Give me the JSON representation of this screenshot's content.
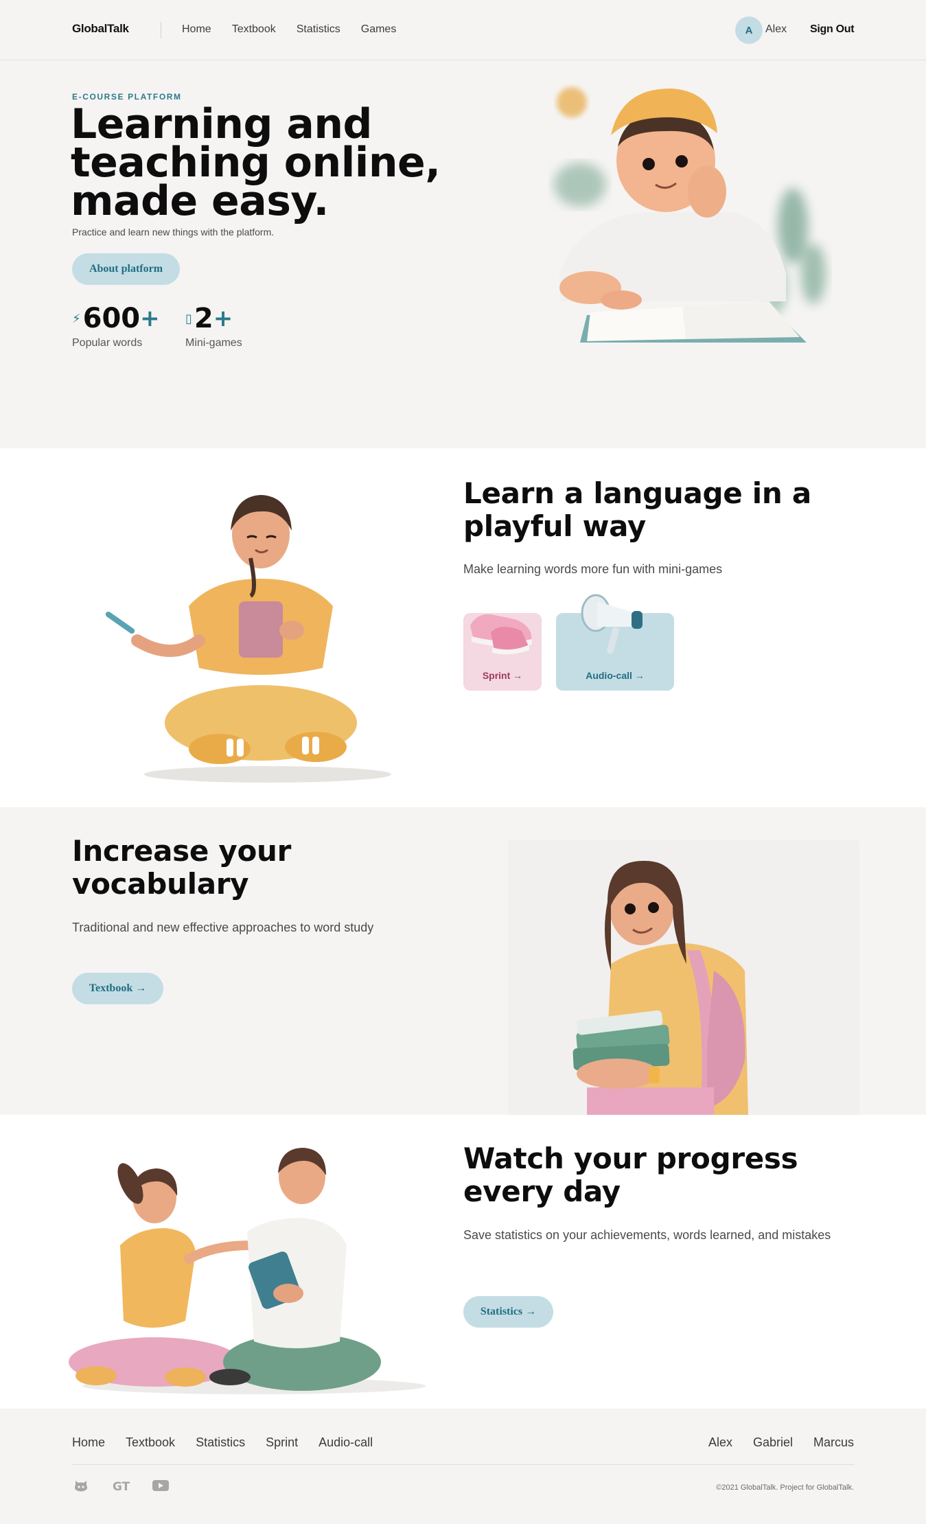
{
  "header": {
    "logo": "GlobalTalk",
    "nav": [
      "Home",
      "Textbook",
      "Statistics",
      "Games"
    ],
    "user": {
      "initial": "A",
      "name": "Alex"
    },
    "sign_out": "Sign Out"
  },
  "hero": {
    "eyebrow": "E-COURSE PLATFORM",
    "title": "Learning and teaching online, made easy.",
    "subtitle": "Practice and learn new things with the platform.",
    "button": "About platform",
    "stats": [
      {
        "value": "600",
        "suffix": "+",
        "label": "Popular words",
        "icon": "lightning-icon"
      },
      {
        "value": "2",
        "suffix": "+",
        "label": "Mini-games",
        "icon": "gamepad-icon"
      }
    ]
  },
  "games_section": {
    "title": "Learn a language in a playful way",
    "subtitle": "Make learning words more fun with mini-games",
    "cards": [
      {
        "label": "Sprint →",
        "icon": "sneaker-icon"
      },
      {
        "label": "Audio-call →",
        "icon": "megaphone-icon"
      }
    ]
  },
  "vocab_section": {
    "title": "Increase your vocabulary",
    "subtitle": "Traditional and new effective approaches to word study",
    "button": "Textbook →"
  },
  "progress_section": {
    "title": "Watch your progress every day",
    "subtitle": "Save statistics on your achievements, words learned, and mistakes",
    "button": "Statistics →"
  },
  "footer": {
    "nav": [
      "Home",
      "Textbook",
      "Statistics",
      "Sprint",
      "Audio-call"
    ],
    "authors": [
      "Alex",
      "Gabriel",
      "Marcus"
    ],
    "icons": [
      "github-icon",
      "gt-logo-icon",
      "youtube-icon"
    ],
    "gt_logo_text": "GT",
    "copyright": "©2021 GlobalTalk. Project for GlobalTalk."
  },
  "colors": {
    "accent": "#2a7a8a",
    "button_bg": "#c4dde4",
    "sprint_card": "#f4d8e2",
    "page_bg": "#f5f4f3"
  }
}
